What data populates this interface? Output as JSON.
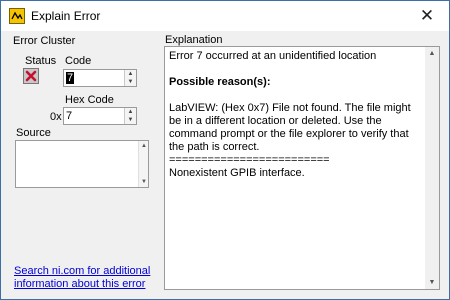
{
  "window": {
    "title": "Explain Error",
    "close_glyph": "✕"
  },
  "error_cluster": {
    "heading": "Error Cluster",
    "status_label": "Status",
    "status_value": "error",
    "status_glyph": "✖",
    "code_label": "Code",
    "code_value": "7",
    "hex_code_label": "Hex Code",
    "hex_prefix": "0x",
    "hex_value": "7",
    "source_label": "Source",
    "source_value": ""
  },
  "link": {
    "line1": "Search ni.com for additional",
    "line2": "information about this error"
  },
  "explanation": {
    "heading": "Explanation",
    "line1": "Error 7 occurred at an unidentified location",
    "reasons_heading": "Possible reason(s):",
    "para": "LabVIEW: (Hex 0x7) File not found. The file might be in a different location or deleted. Use the command prompt or the file explorer to verify that the path is correct.",
    "separator": "=========================",
    "line_last": "Nonexistent GPIB interface."
  },
  "icons": {
    "app": "labview-icon",
    "close": "close-icon",
    "status": "error-x-icon"
  },
  "colors": {
    "status_x": "#c8102e",
    "link": "#0000d6",
    "app_icon": "#f5c400"
  }
}
